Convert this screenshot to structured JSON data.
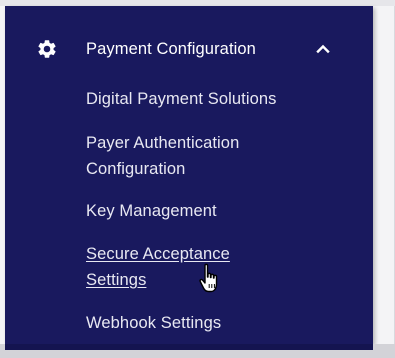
{
  "sidebar": {
    "group": {
      "icon": "gear-icon",
      "title": "Payment Configuration",
      "expanded": true,
      "toggle_icon": "chevron-up-icon"
    },
    "items": [
      {
        "label": "Digital Payment Solutions"
      },
      {
        "label": "Payer Authentication Configuration"
      },
      {
        "label": "Key Management"
      },
      {
        "label": "Secure Acceptance Settings",
        "hovered": true
      },
      {
        "label": "Webhook Settings"
      }
    ]
  },
  "pointer": {
    "icon": "hand-pointer-icon"
  },
  "colors": {
    "panel_background": "#19195e",
    "text": "#ffffff",
    "page_background": "#f4f4f6"
  }
}
